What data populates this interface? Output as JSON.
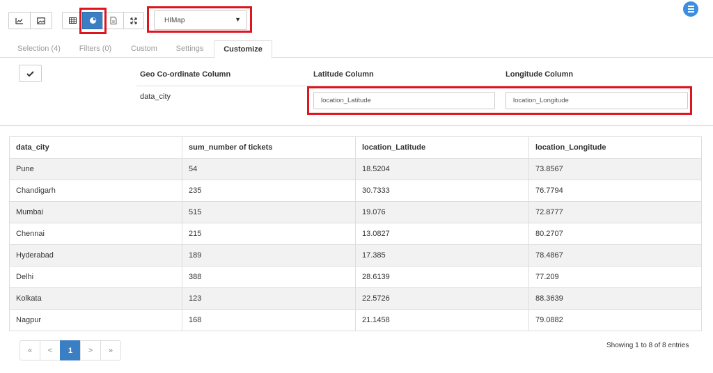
{
  "toolbar": {
    "chart_type_select": {
      "selected": "HIMap",
      "caret": "▼"
    }
  },
  "tabs": [
    {
      "label": "Selection (4)"
    },
    {
      "label": "Filters (0)"
    },
    {
      "label": "Custom"
    },
    {
      "label": "Settings"
    },
    {
      "label": "Customize"
    }
  ],
  "config": {
    "headers": {
      "geo": "Geo Co-ordinate Column",
      "latitude": "Latitude Column",
      "longitude": "Longitude Column"
    },
    "geo_value": "data_city",
    "latitude_value": "location_Latitude",
    "longitude_value": "location_Longitude"
  },
  "table": {
    "columns": [
      "data_city",
      "sum_number of tickets",
      "location_Latitude",
      "location_Longitude"
    ],
    "rows": [
      [
        "Pune",
        "54",
        "18.5204",
        "73.8567"
      ],
      [
        "Chandigarh",
        "235",
        "30.7333",
        "76.7794"
      ],
      [
        "Mumbai",
        "515",
        "19.076",
        "72.8777"
      ],
      [
        "Chennai",
        "215",
        "13.0827",
        "80.2707"
      ],
      [
        "Hyderabad",
        "189",
        "17.385",
        "78.4867"
      ],
      [
        "Delhi",
        "388",
        "28.6139",
        "77.209"
      ],
      [
        "Kolkata",
        "123",
        "22.5726",
        "88.3639"
      ],
      [
        "Nagpur",
        "168",
        "21.1458",
        "79.0882"
      ]
    ]
  },
  "pagination": {
    "first": "«",
    "prev": "<",
    "current": "1",
    "next": ">",
    "last": "»",
    "summary": "Showing 1 to 8 of 8 entries"
  },
  "colors": {
    "accent": "#3a7fc4",
    "highlight": "#e0141e",
    "fab": "#3b8ee0"
  }
}
